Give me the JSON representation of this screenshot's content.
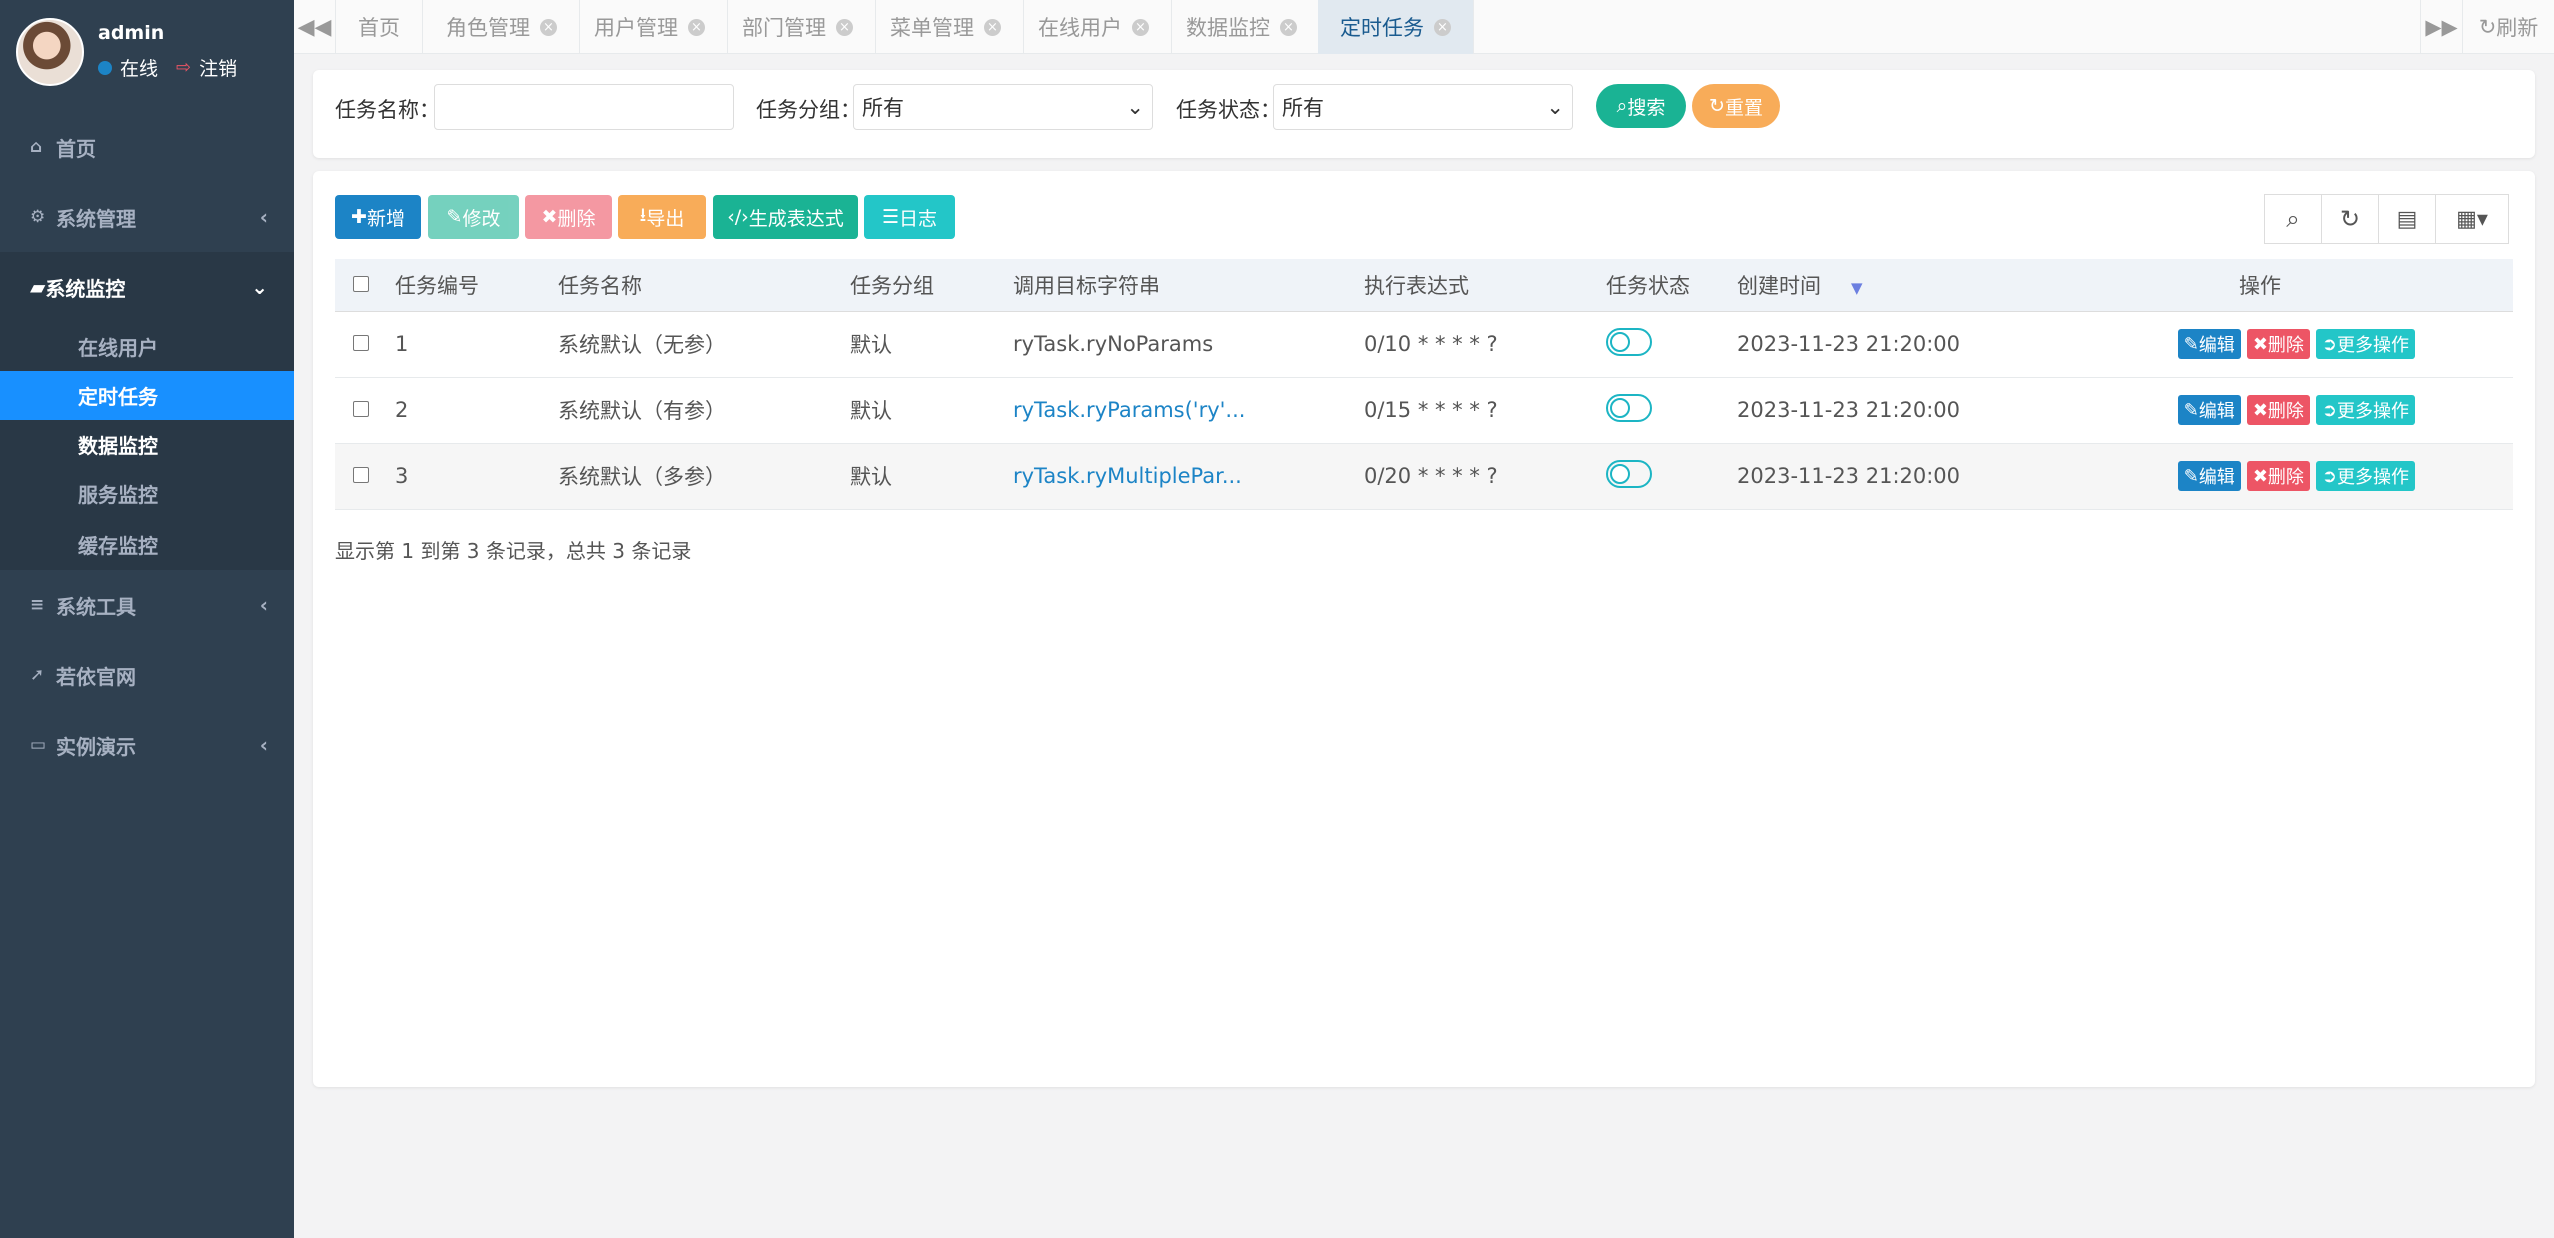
{
  "user": {
    "name": "admin",
    "status": "在线",
    "logout": "注销"
  },
  "nav": {
    "home": "首页",
    "system": "系统管理",
    "monitor": "系统监控",
    "monitor_items": [
      "在线用户",
      "定时任务",
      "数据监控",
      "服务监控",
      "缓存监控"
    ],
    "tools": "系统工具",
    "site": "若依官网",
    "demo": "实例演示"
  },
  "tabs": [
    "首页",
    "角色管理",
    "用户管理",
    "部门管理",
    "菜单管理",
    "在线用户",
    "数据监控",
    "定时任务"
  ],
  "topbar": {
    "refresh": "刷新"
  },
  "search": {
    "name_label": "任务名称：",
    "name_value": "",
    "group_label": "任务分组：",
    "group_value": "所有",
    "status_label": "任务状态：",
    "status_value": "所有",
    "search_btn": "搜索",
    "reset_btn": "重置"
  },
  "toolbar": {
    "add": "新增",
    "edit": "修改",
    "delete": "删除",
    "export": "导出",
    "cron": "生成表达式",
    "log": "日志"
  },
  "table": {
    "headers": [
      "任务编号",
      "任务名称",
      "任务分组",
      "调用目标字符串",
      "执行表达式",
      "任务状态",
      "创建时间",
      "操作"
    ],
    "rows": [
      {
        "id": "1",
        "name": "系统默认（无参）",
        "group": "默认",
        "target": "ryTask.ryNoParams",
        "cron": "0/10 * * * * ?",
        "time": "2023-11-23 21:20:00"
      },
      {
        "id": "2",
        "name": "系统默认（有参）",
        "group": "默认",
        "target": "ryTask.ryParams('ry'...",
        "cron": "0/15 * * * * ?",
        "time": "2023-11-23 21:20:00"
      },
      {
        "id": "3",
        "name": "系统默认（多参）",
        "group": "默认",
        "target": "ryTask.ryMultiplePar...",
        "cron": "0/20 * * * * ?",
        "time": "2023-11-23 21:20:00"
      }
    ],
    "op_labels": {
      "edit": "编辑",
      "delete": "删除",
      "more": "更多操作"
    }
  },
  "pagination": "显示第 1 到第 3 条记录，总共 3 条记录",
  "colors": {
    "sidebar": "#2f4050",
    "active": "#1890ff",
    "primary": "#1c84c6",
    "success": "#1ab394",
    "warning": "#f8ac59",
    "danger": "#ed5565",
    "info": "#23c6c8"
  }
}
